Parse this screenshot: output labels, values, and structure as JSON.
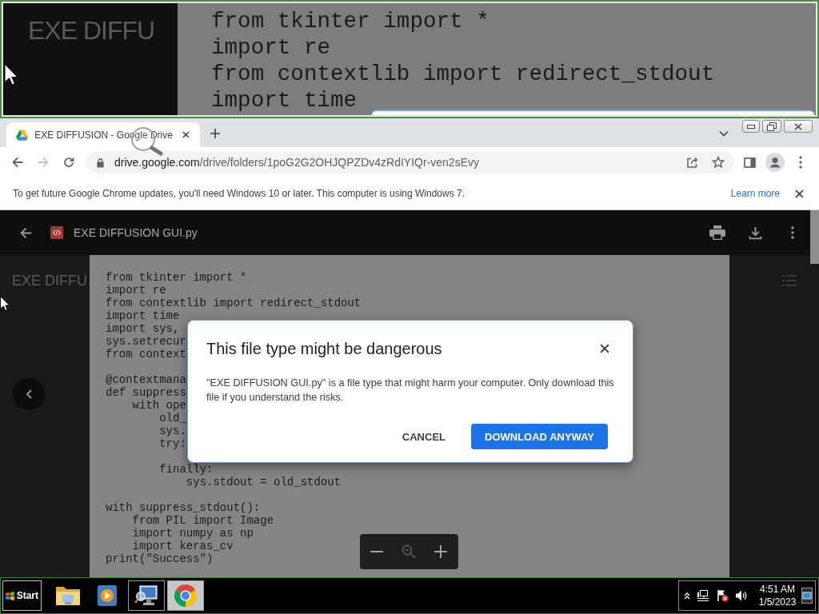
{
  "magnifier": {
    "background_title": "EXE DIFFU",
    "code_lines": [
      "from tkinter import *",
      "import re",
      "from contextlib import redirect_stdout",
      "import time"
    ]
  },
  "browser": {
    "tabs": [
      {
        "title": "EXE DIFFUSION - Google Drive",
        "selected": true
      }
    ],
    "nav_buttons": [
      {
        "kind": "back",
        "disabled": false
      },
      {
        "kind": "forward",
        "disabled": true
      },
      {
        "kind": "reload",
        "disabled": false
      }
    ],
    "url": "drive.google.com/drive/folders/1poG2G2OHJQPZDv4zRdIYIQr-ven2sEvy"
  },
  "infobar": {
    "message": "To get future Google Chrome updates, you'll need Windows 10 or later. This computer is using Windows 7.",
    "link": "Learn more"
  },
  "viewer": {
    "file_name": "EXE DIFFUSION GUI.py",
    "background_title": "EXE DIFFU",
    "code_blocks": [
      [
        "from tkinter import *",
        "import re",
        "from contextlib import redirect_stdout",
        "import time",
        "import sys,",
        "sys.setrecur",
        "from context"
      ],
      [
        "@contextmana",
        "def suppress",
        "    with ope",
        "        old_",
        "        sys.",
        "        try:"
      ],
      [
        "        finally:",
        "            sys.stdout = old_stdout"
      ],
      [
        "with suppress_stdout():",
        "    from PIL import Image",
        "    import numpy as np",
        "    import keras_cv",
        "print(\"Success\")"
      ]
    ],
    "zoom_controls": [
      {
        "kind": "zoom-out",
        "disabled": false
      },
      {
        "kind": "reset",
        "disabled": true
      },
      {
        "kind": "zoom-in",
        "disabled": false
      }
    ]
  },
  "dialog": {
    "title": "This file type might be dangerous",
    "message": "\"EXE DIFFUSION GUI.py\" is a file type that might harm your computer. Only download this file if you understand the risks.",
    "buttons": [
      {
        "label": "CANCEL",
        "kind": "text"
      },
      {
        "label": "DOWNLOAD ANYWAY",
        "kind": "primary"
      }
    ]
  },
  "taskbar": {
    "start_label": "Start",
    "apps": [
      {
        "kind": "explorer",
        "running": false,
        "selected": false
      },
      {
        "kind": "media",
        "running": false,
        "selected": false
      },
      {
        "kind": "remote",
        "running": true,
        "selected": false
      },
      {
        "kind": "browser",
        "running": true,
        "selected": true
      }
    ],
    "time": "4:51 AM",
    "date": "1/5/2023"
  }
}
